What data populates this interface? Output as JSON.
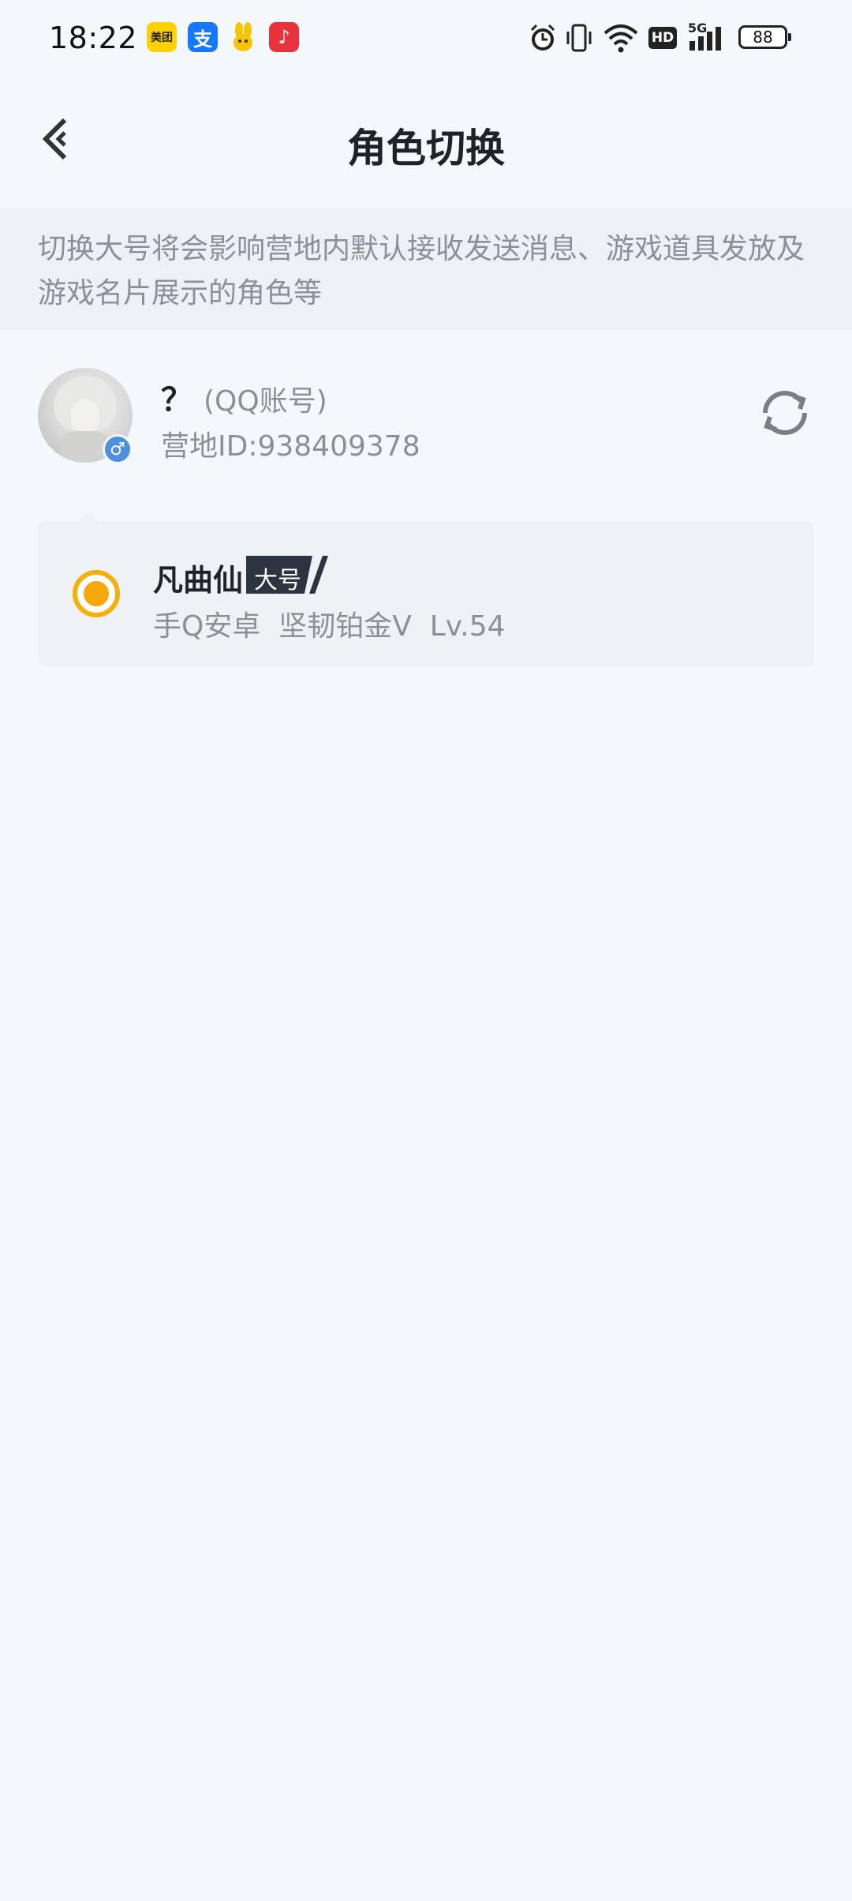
{
  "status_bar": {
    "time": "18:22",
    "battery": "88",
    "network": "5G",
    "hd_label": "HD",
    "apps": [
      {
        "name": "meituan",
        "label": "美团"
      },
      {
        "name": "alipay",
        "label": "支"
      },
      {
        "name": "rabbit"
      },
      {
        "name": "music",
        "label": "♪"
      }
    ]
  },
  "header": {
    "title": "角色切换"
  },
  "notice": {
    "text": "切换大号将会影响营地内默认接收发送消息、游戏道具发放及游戏名片展示的角色等"
  },
  "account": {
    "name": "？",
    "account_type": "(QQ账号)",
    "camp_id": "营地ID:938409378",
    "gender_symbol": "♂"
  },
  "roles": [
    {
      "name": "凡曲仙",
      "badge": "大号",
      "info": "手Q安卓  坚韧铂金V  Lv.54",
      "selected": true
    }
  ],
  "colors": {
    "accent": "#f5a80a",
    "background": "#f5f8fb",
    "notice_bg": "#edf1f5",
    "muted_text": "#8a9099",
    "badge_bg": "#2b3440",
    "gender_blue": "#4f8fe0"
  }
}
